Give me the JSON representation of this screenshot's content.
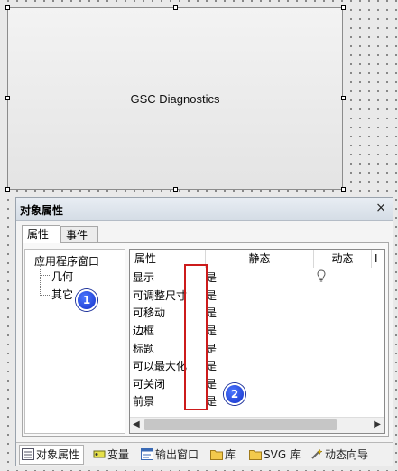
{
  "canvas": {
    "object_caption": "GSC Diagnostics"
  },
  "dialog": {
    "title": "对象属性",
    "close": "×",
    "tabs": [
      "属性",
      "事件"
    ]
  },
  "tree": {
    "root": "应用程序窗口",
    "children": [
      "几何",
      "其它"
    ]
  },
  "grid": {
    "columns": [
      "属性",
      "静态",
      "动态",
      "I"
    ],
    "rows": [
      {
        "name": "显示",
        "value": "是",
        "dynamic_icon": "lightbulb-icon"
      },
      {
        "name": "可调整尺寸",
        "value": "是"
      },
      {
        "name": "可移动",
        "value": "是"
      },
      {
        "name": "边框",
        "value": "是"
      },
      {
        "name": "标题",
        "value": "是"
      },
      {
        "name": "可以最大化",
        "value": "是"
      },
      {
        "name": "可关闭",
        "value": "是"
      },
      {
        "name": "前景",
        "value": "是"
      }
    ],
    "scroll_left": "◀",
    "scroll_right": "▶"
  },
  "annotations": {
    "badge_1": "1",
    "badge_2": "2",
    "highlight_color": "#cc1b1b",
    "badge_color": "#1f3fe0"
  },
  "bottom_tabs": [
    {
      "label": "对象属性",
      "icon": "properties-icon"
    },
    {
      "label": "变量",
      "icon": "variable-icon"
    },
    {
      "label": "输出窗口",
      "icon": "output-window-icon"
    },
    {
      "label": "库",
      "icon": "library-folder-icon"
    },
    {
      "label": "SVG 库",
      "icon": "svg-library-folder-icon"
    },
    {
      "label": "动态向导",
      "icon": "dynamic-wizard-icon"
    }
  ]
}
